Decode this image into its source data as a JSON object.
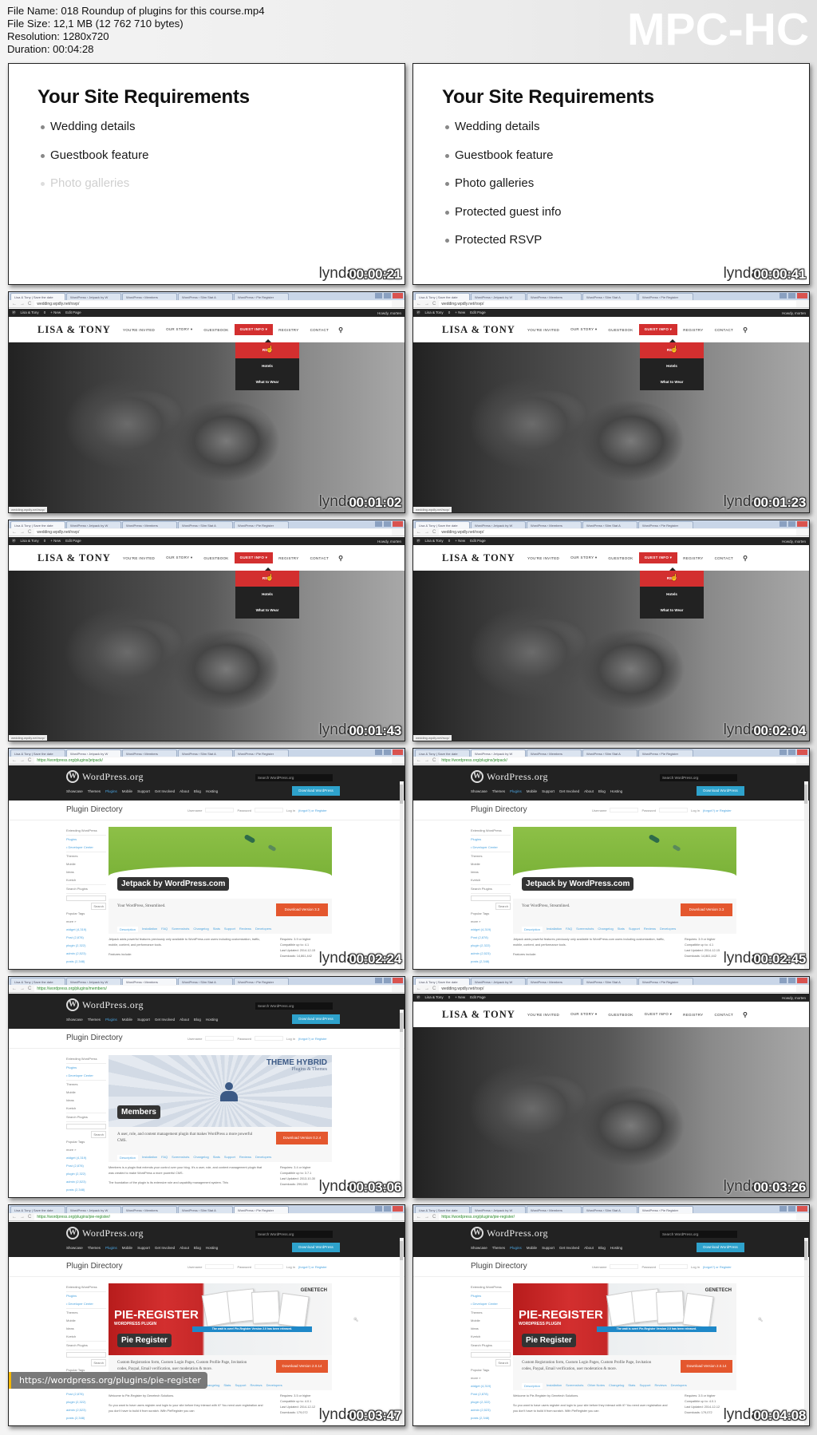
{
  "file_info": {
    "file_name": "File Name: 018 Roundup of plugins for this course.mp4",
    "file_size": "File Size: 12,1 MB (12 762 710 bytes)",
    "resolution": "Resolution: 1280x720",
    "duration": "Duration: 00:04:28"
  },
  "brand": "MPC-HC",
  "watermark": "lynda",
  "slides": {
    "title": "Your Site Requirements",
    "items": [
      "Wedding details",
      "Guestbook feature",
      "Photo galleries",
      "Protected guest info",
      "Protected RSVP"
    ]
  },
  "browser": {
    "tabs": [
      "Lisa & Tony | Save the date",
      "WordPress › Jetpack by W",
      "WordPress › Members",
      "WordPress › Slim Stat A",
      "WordPress › Pie Register"
    ],
    "wedding_url": "wedding.wpdly.net/rsvp/",
    "jetpack_url": "https://wordpress.org/plugins/jetpack/",
    "members_url": "https://wordpress.org/plugins/members/",
    "pie_url": "https://wordpress.org/plugins/pie-register/"
  },
  "wedding_site": {
    "admin_bar": [
      "Lisa & Tony",
      "0",
      "+ New",
      "Edit Page"
    ],
    "howdy": "Howdy, morten",
    "logo": "LISA & TONY",
    "menu": [
      "YOU'RE INVITED",
      "OUR STORY ▾",
      "GUESTBOOK",
      "GUEST INFO ▾",
      "REGISTRY",
      "CONTACT"
    ],
    "dropdown": [
      "RSVP",
      "Hotels",
      "What to Wear"
    ],
    "status_url": "wedding.wpdly.net/rsvp/"
  },
  "wporg": {
    "logo": "WordPress.org",
    "nav": [
      "Showcase",
      "Themes",
      "Plugins",
      "Mobile",
      "Support",
      "Get Involved",
      "About",
      "Blog",
      "Hosting"
    ],
    "search_placeholder": "Search WordPress.org",
    "download_wp": "Download WordPress",
    "plugin_directory": "Plugin Directory",
    "username": "Username",
    "password": "Password",
    "login": "Log in",
    "register": "(forgot?) or Register",
    "sidebar": [
      "Extending WordPress",
      "Plugins",
      "• Developer Center",
      "Themes",
      "Mobile",
      "Ideas",
      "Kvetch",
      "Search Plugins",
      "Search",
      "Popular Tags",
      "more »",
      "widget (4,319)",
      "Post (2,878)",
      "plugin (2,322)",
      "admin (2,523)",
      "posts (2,348)"
    ],
    "plugin_tabs": [
      "Description",
      "Installation",
      "FAQ",
      "Screenshots",
      "Changelog",
      "Stats",
      "Support",
      "Reviews",
      "Developers"
    ],
    "pie_tabs": [
      "Description",
      "Installation",
      "Screenshots",
      "Other Notes",
      "Changelog",
      "Stats",
      "Support",
      "Reviews",
      "Developers"
    ]
  },
  "plugins": {
    "jetpack": {
      "name": "Jetpack by WordPress.com",
      "tagline": "Your WordPress, Streamlined.",
      "download": "Download Version 3.3",
      "content": "Jetpack adds powerful features previously only available to WordPress.com users including customization, traffic, mobile, content, and performance tools.",
      "features": "Features include:",
      "meta": [
        "Requires: 3.9 or higher",
        "Compatible up to: 4.1",
        "Last Updated: 2014-12-15",
        "Downloads: 14,861,442"
      ]
    },
    "members": {
      "name": "Members",
      "banner_title": "THEME HYBRID",
      "banner_sub": "Plugins & Themes",
      "tagline": "A user, role, and content management plugin that makes WordPress a more powerful CMS.",
      "download": "Download Version 0.2.4",
      "content": "Members is a plugin that extends your control over your blog. It's a user, role, and content management plugin that was created to make WordPress a more powerful CMS.",
      "content2": "The foundation of the plugin is its extensive role and capability management system. This",
      "meta": [
        "Requires: 3.4 or higher",
        "Compatible up to: 3.7.1",
        "Last Updated: 2013-10-30",
        "Downloads: 299,045"
      ]
    },
    "pie": {
      "name": "Pie Register",
      "banner_title": "PIE-REGISTER",
      "banner_sub": "WORDPRESS PLUGIN",
      "genetech": "GENETECH",
      "ribbon": "The wait is over! Pie-Register Version 2.0 has been released.",
      "tagline": "Custom Registration form, Custom Login Pages, Custom Profile Page, Invitation codes, Paypal, Email verification, user moderation & more.",
      "download": "Download Version 2.0.14",
      "content": "Welcome to Pie-Register by Genetech Solutions.",
      "content2": "So you want to have users register and login to your site before they interact with it? You need user registration and you don't have to build it from scratch. With PieRegister you can",
      "meta": [
        "Requires: 3.5 or higher",
        "Compatible up to: 4.0.1",
        "Last Updated: 2014-12-12",
        "Downloads: 179,072"
      ]
    }
  },
  "url_overlay": "https://wordpress.org/plugins/pie-register",
  "thumbnails": [
    {
      "time": "00:00:21",
      "visible_items": 3
    },
    {
      "time": "00:00:41",
      "visible_items": 5
    },
    {
      "time": "00:01:02"
    },
    {
      "time": "00:01:23"
    },
    {
      "time": "00:01:43"
    },
    {
      "time": "00:02:04"
    },
    {
      "time": "00:02:24"
    },
    {
      "time": "00:02:45"
    },
    {
      "time": "00:03:06"
    },
    {
      "time": "00:03:26"
    },
    {
      "time": "00:03:47"
    },
    {
      "time": "00:04:08"
    }
  ],
  "colors": {
    "wedding_accent": "#d32f2f",
    "wp_blue": "#2ea2cc",
    "wp_dark": "#222222",
    "download_orange": "#e4572e",
    "overlay_accent": "#f5b800"
  }
}
